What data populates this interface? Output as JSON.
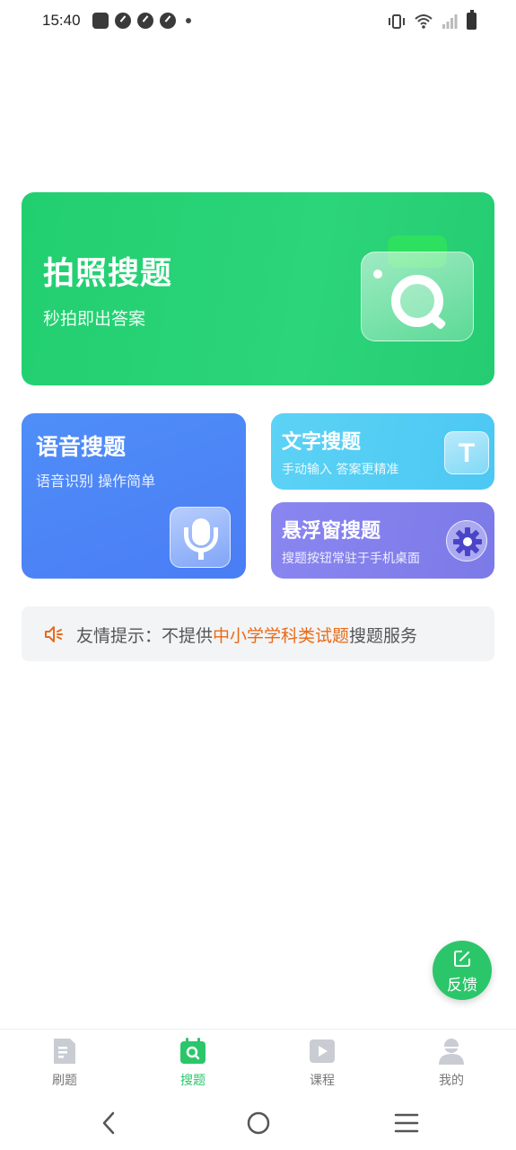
{
  "status_bar": {
    "time": "15:40"
  },
  "photo_search": {
    "title": "拍照搜题",
    "subtitle": "秒拍即出答案"
  },
  "voice_search": {
    "title": "语音搜题",
    "subtitle": "语音识别 操作简单"
  },
  "text_search": {
    "title": "文字搜题",
    "subtitle": "手动输入 答案更精准",
    "icon_letter": "T"
  },
  "float_search": {
    "title": "悬浮窗搜题",
    "subtitle": "搜题按钮常驻于手机桌面"
  },
  "tip": {
    "prefix": "友情提示：不提供",
    "highlight": "中小学学科类试题",
    "suffix": "搜题服务"
  },
  "feedback": {
    "label": "反馈"
  },
  "bottom_nav": {
    "items": [
      {
        "label": "刷题",
        "icon": "document-icon"
      },
      {
        "label": "搜题",
        "icon": "search-icon"
      },
      {
        "label": "课程",
        "icon": "play-icon"
      },
      {
        "label": "我的",
        "icon": "user-icon"
      }
    ],
    "active_index": 1
  },
  "colors": {
    "accent_green": "#2bc66a",
    "photo_card": "#25cc72",
    "voice_card": "#4a7df5",
    "text_card": "#4cc8f3",
    "float_card": "#7c7ae8",
    "tip_highlight": "#ea6a16"
  }
}
